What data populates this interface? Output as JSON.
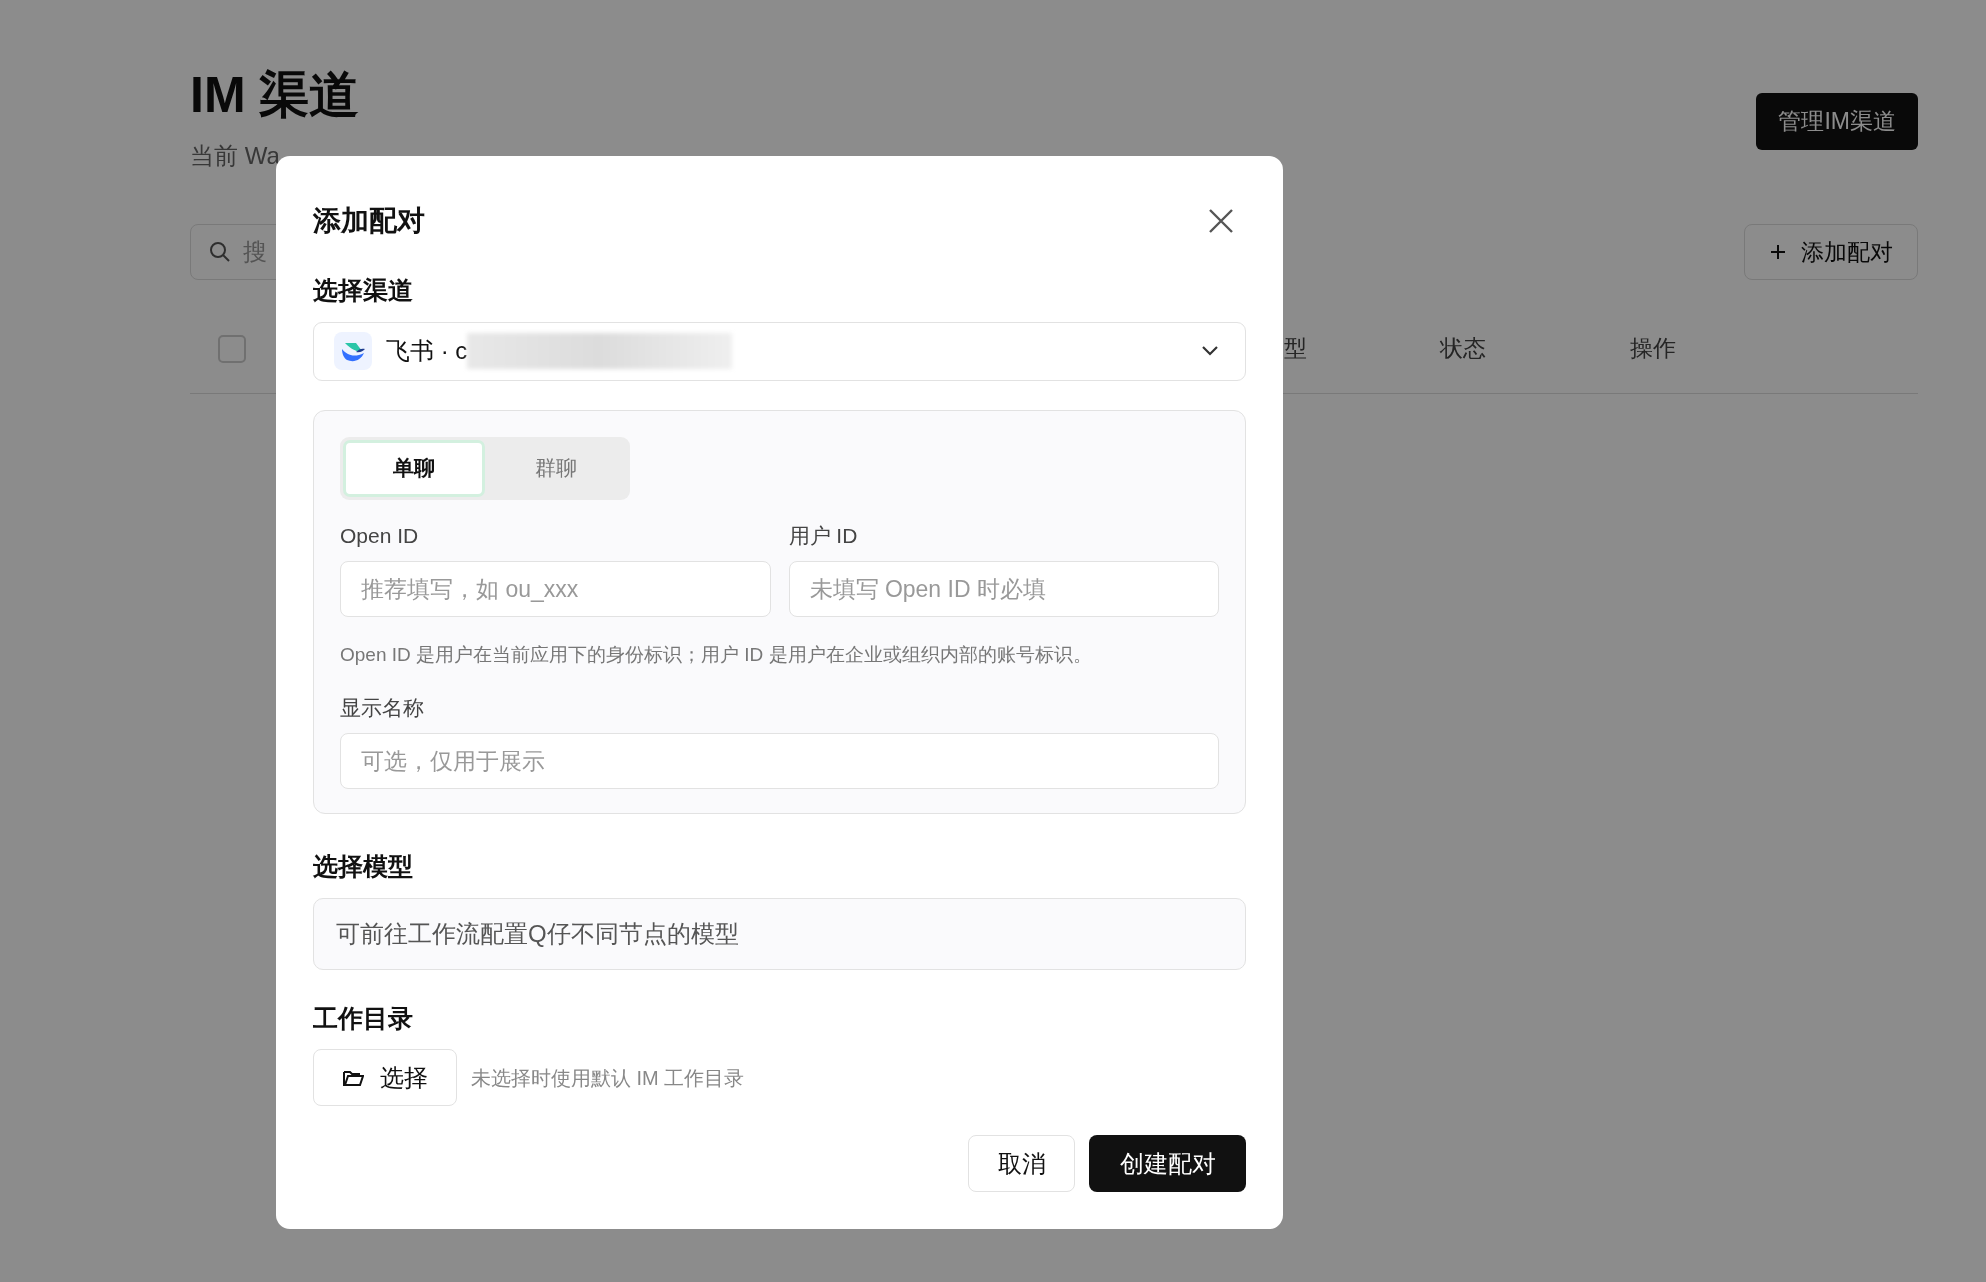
{
  "page": {
    "title": "IM 渠道",
    "subtitle": "当前 Wa",
    "manage_button": "管理IM渠道",
    "search": {
      "placeholder": "搜"
    },
    "add_button": "添加配对",
    "table": {
      "select_all": {
        "checked": false
      },
      "columns": [
        "型",
        "状态",
        "操作"
      ]
    }
  },
  "dialog": {
    "title": "添加配对",
    "channel": {
      "label": "选择渠道",
      "value": "飞书 · c"
    },
    "chat_types": [
      {
        "label": "单聊",
        "selected": true
      },
      {
        "label": "群聊",
        "selected": false
      }
    ],
    "open_id": {
      "label": "Open ID",
      "placeholder": "推荐填写，如 ou_xxx"
    },
    "user_id": {
      "label": "用户 ID",
      "placeholder": "未填写 Open ID 时必填"
    },
    "help": "Open ID 是用户在当前应用下的身份标识；用户 ID 是用户在企业或组织内部的账号标识。",
    "display_name": {
      "label": "显示名称",
      "placeholder": "可选，仅用于展示"
    },
    "model": {
      "label": "选择模型",
      "value": "可前往工作流配置Q仔不同节点的模型"
    },
    "workdir": {
      "label": "工作目录",
      "button": "选择",
      "hint": "未选择时使用默认 IM 工作目录"
    },
    "buttons": {
      "cancel": "取消",
      "create": "创建配对"
    }
  }
}
